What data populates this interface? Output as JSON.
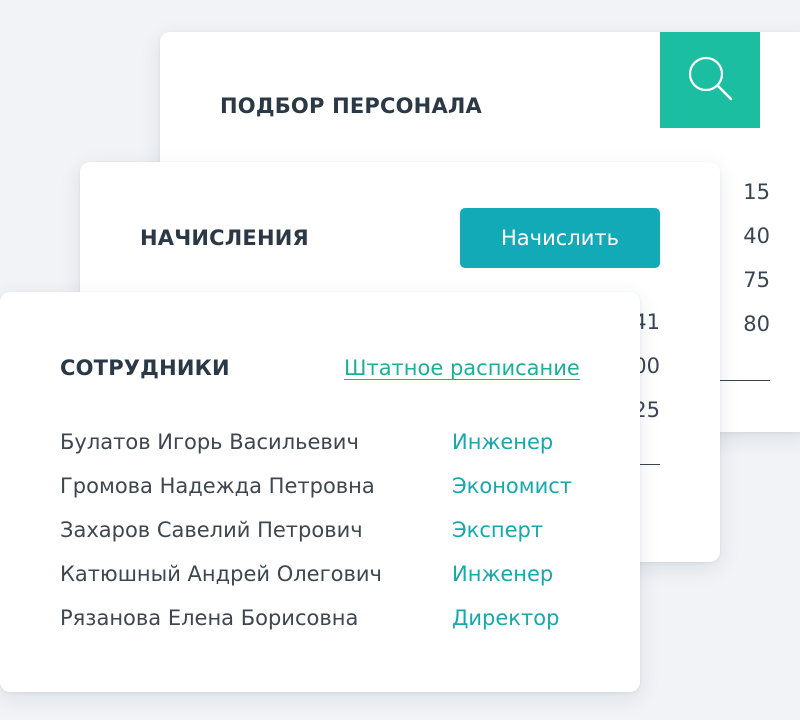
{
  "recruitment": {
    "title": "ПОДБОР ПЕРСОНАЛА",
    "search_icon": "search-icon",
    "tile_color": "#1bbea0",
    "numbers": [
      "15",
      "40",
      "75",
      "80"
    ]
  },
  "accruals": {
    "title": "НАЧИСЛЕНИЯ",
    "button_label": "Начислить",
    "button_color": "#12aab7",
    "numbers": [
      "41",
      "00",
      "25"
    ]
  },
  "employees": {
    "title": "СОТРУДНИКИ",
    "staff_link": "Штатное расписание",
    "rows": [
      {
        "name": "Булатов Игорь Васильевич",
        "role": "Инженер"
      },
      {
        "name": "Громова Надежда Петровна",
        "role": "Экономист"
      },
      {
        "name": "Захаров Савелий Петрович",
        "role": "Эксперт"
      },
      {
        "name": "Катюшный Андрей Олегович",
        "role": "Инженер"
      },
      {
        "name": "Рязанова Елена Борисовна",
        "role": "Директор"
      }
    ]
  }
}
